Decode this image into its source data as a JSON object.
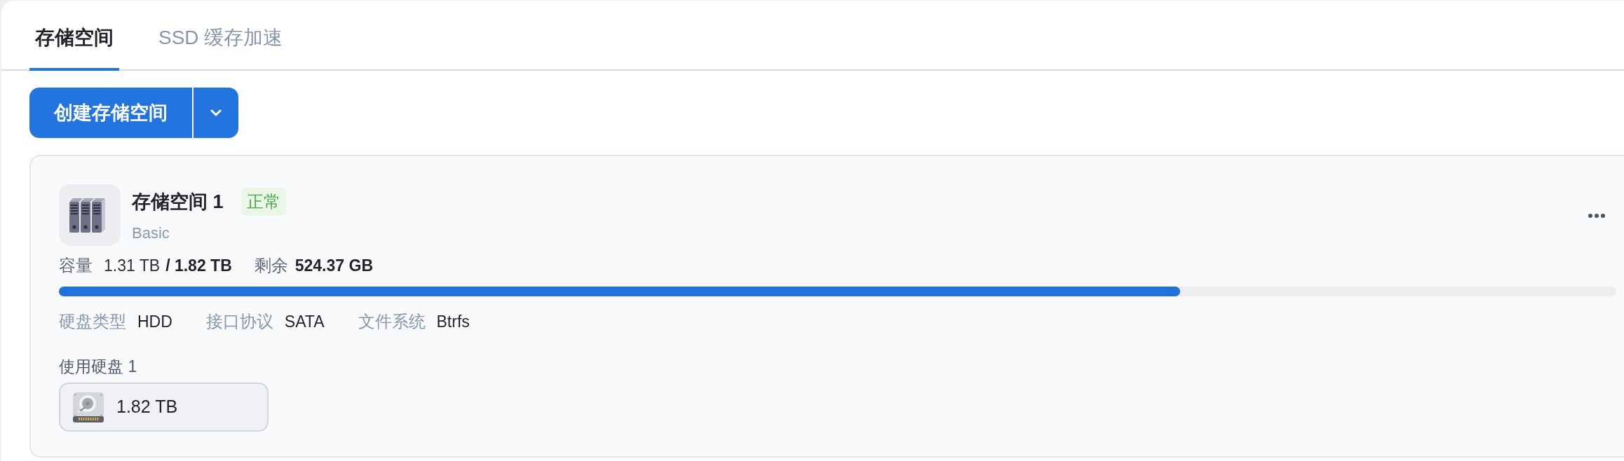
{
  "tabs": [
    {
      "label": "存储空间",
      "selected": true
    },
    {
      "label": "SSD 缓存加速",
      "selected": false
    }
  ],
  "toolbar": {
    "create_button": "创建存储空间"
  },
  "storage_pools": [
    {
      "name": "存储空间 1",
      "status": "正常",
      "raid_type": "Basic",
      "capacity": {
        "label": "容量",
        "used": "1.31 TB",
        "total": "/ 1.82 TB"
      },
      "free": {
        "label": "剩余",
        "value": "524.37 GB"
      },
      "level": 0.72,
      "details": [
        {
          "label": "硬盘类型",
          "value": "HDD"
        },
        {
          "label": "接口协议",
          "value": "SATA"
        },
        {
          "label": "文件系统",
          "value": "Btrfs"
        }
      ],
      "disks_label": "使用硬盘 1",
      "disks": [
        {
          "size": "1.82 TB"
        }
      ]
    }
  ]
}
